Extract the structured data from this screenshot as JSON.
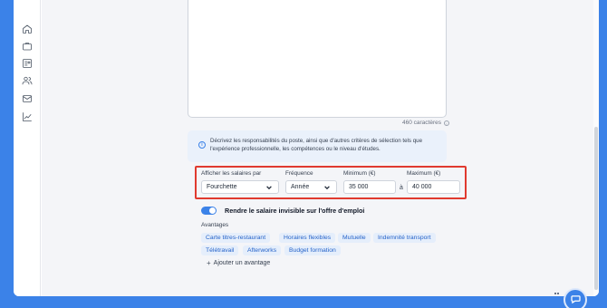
{
  "sidebar": {
    "items": [
      {
        "icon": "home-icon"
      },
      {
        "icon": "briefcase-icon"
      },
      {
        "icon": "candidates-list-icon"
      },
      {
        "icon": "users-icon"
      },
      {
        "icon": "mail-icon"
      },
      {
        "icon": "chart-icon"
      }
    ]
  },
  "description": {
    "char_count": "460 caractères"
  },
  "info": {
    "text": "Décrivez les responsabilités du poste, ainsi que d'autres critères de sélection tels que l'expérience professionnelle, les compétences ou le niveau d'études."
  },
  "salary": {
    "display_label": "Afficher les salaires par",
    "display_value": "Fourchette",
    "frequency_label": "Fréquence",
    "frequency_value": "Année",
    "min_label": "Minimum (€)",
    "min_value": "35 000",
    "range_separator": "à",
    "max_label": "Maximum (€)",
    "max_value": "40 000"
  },
  "visibility": {
    "toggle_label": "Rendre le salaire invisible sur l'offre d'emploi",
    "toggle_on": true
  },
  "benefits": {
    "title": "Avantages",
    "chips": [
      "Carte titres-restaurant",
      "Horaires flexibles",
      "Mutuelle",
      "Indemnité transport",
      "Télétravail",
      "Afterworks",
      "Budget formation"
    ],
    "add_label": "Ajouter un avantage"
  },
  "colors": {
    "accent": "#3b82e8",
    "highlight_border": "#e03a2f",
    "chip_bg": "#e5eefb",
    "chip_text": "#2563c9"
  }
}
